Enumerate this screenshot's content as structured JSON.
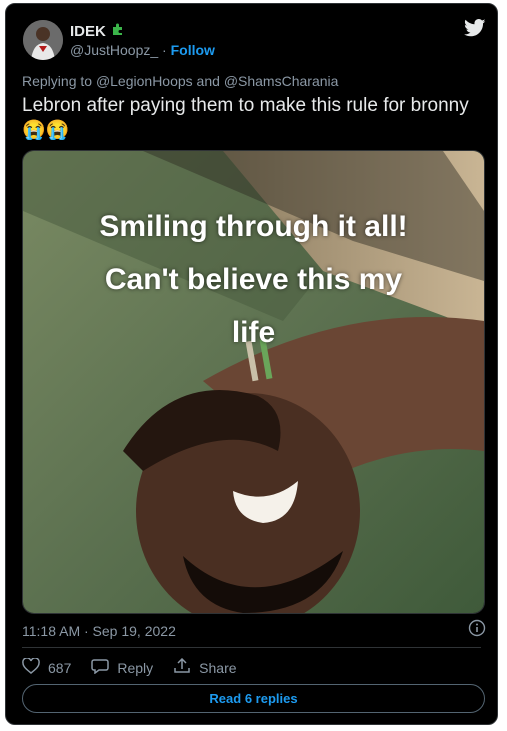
{
  "tweet": {
    "author_name": "IDEK",
    "author_handle": "@JustHoopz_",
    "separator": " · ",
    "follow_label": "Follow",
    "replying_prefix": "Replying to ",
    "mention_1": "@LegionHoops",
    "and_text": " and ",
    "mention_2": "@ShamsCharania",
    "text": "Lebron after paying them to make this rule for bronny 😭😭",
    "media_caption_lines": [
      "Smiling through it all!",
      "Can't believe this my",
      "life"
    ],
    "timestamp": "11:18 AM · Sep 19, 2022",
    "like_count": "687",
    "reply_label": "Reply",
    "share_label": "Share",
    "read_replies_label": "Read 6 replies"
  },
  "icons": {
    "brand": "twitter-bird-icon",
    "badge": "puzzle-piece-icon",
    "info": "info-icon",
    "like": "heart-icon",
    "reply": "speech-bubble-icon",
    "share": "share-upload-icon"
  },
  "colors": {
    "background": "#000000",
    "text": "#e7e9ea",
    "muted": "#8b98a5",
    "accent": "#1d9bf0",
    "badge": "#3bb54a"
  }
}
